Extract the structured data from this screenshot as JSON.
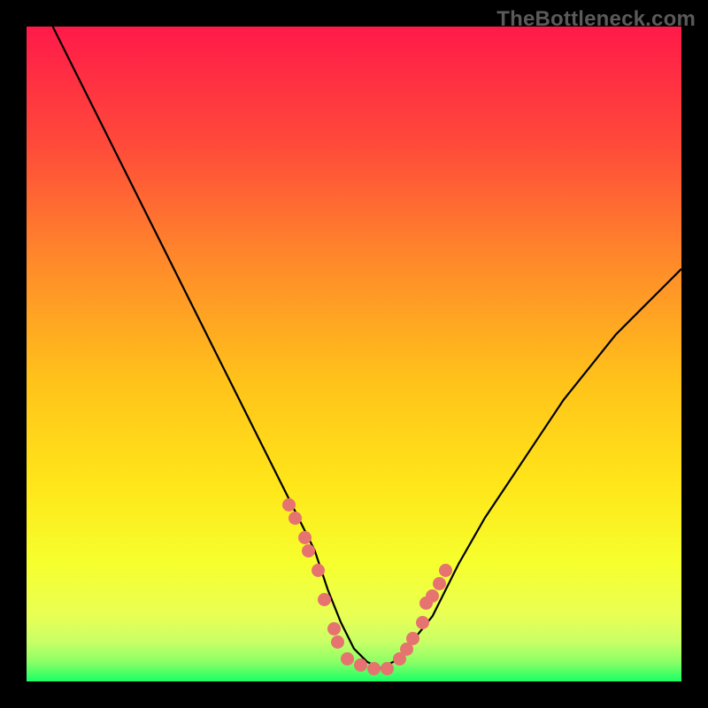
{
  "watermark": "TheBottleneck.com",
  "chart_data": {
    "type": "line",
    "title": "",
    "xlabel": "",
    "ylabel": "",
    "xlim": [
      0,
      100
    ],
    "ylim": [
      0,
      100
    ],
    "grid": false,
    "series": [
      {
        "name": "curve",
        "x": [
          4,
          8,
          12,
          16,
          20,
          24,
          28,
          32,
          36,
          40,
          44,
          46,
          48,
          50,
          52,
          54,
          56,
          58,
          62,
          66,
          70,
          74,
          78,
          82,
          86,
          90,
          94,
          98,
          100
        ],
        "y": [
          100,
          92,
          84,
          76,
          68,
          60,
          52,
          44,
          36,
          28,
          20,
          14,
          9,
          5,
          3,
          2,
          3,
          5,
          10,
          18,
          25,
          31,
          37,
          43,
          48,
          53,
          57,
          61,
          63
        ]
      }
    ],
    "markers": {
      "name": "scatter-points",
      "x": [
        40.0,
        41.0,
        42.5,
        43.0,
        44.5,
        45.5,
        47.0,
        47.5,
        49.0,
        51.0,
        53.0,
        55.0,
        57.0,
        58.0,
        59.0,
        60.5,
        61.0,
        62.0,
        63.0,
        64.0
      ],
      "y": [
        27.0,
        25.0,
        22.0,
        20.0,
        17.0,
        12.5,
        8.0,
        6.0,
        3.5,
        2.5,
        2.0,
        2.0,
        3.5,
        5.0,
        6.5,
        9.0,
        12.0,
        13.0,
        15.0,
        17.0
      ],
      "color": "#e6736f"
    },
    "gradient_colors": {
      "top": "#ff1a49",
      "upper_mid": "#ff8a2a",
      "mid": "#ffd91a",
      "lower_mid": "#f3ff33",
      "low_band": "#d8ff66",
      "bottom": "#1aff66"
    }
  }
}
